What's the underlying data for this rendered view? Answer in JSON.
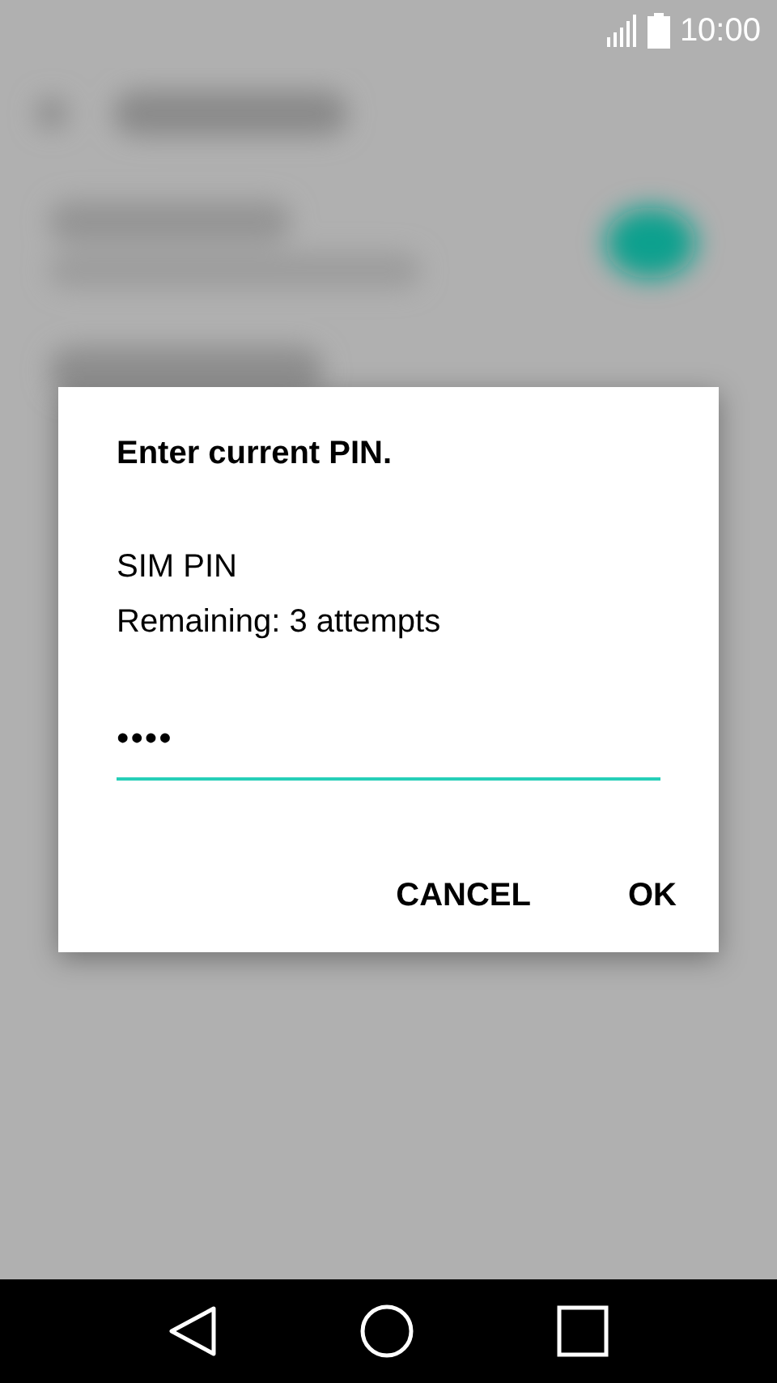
{
  "status_bar": {
    "time": "10:00"
  },
  "dialog": {
    "title": "Enter current PIN.",
    "lines": [
      "SIM PIN",
      "Remaining: 3 attempts"
    ],
    "pin_field": {
      "value": "••••",
      "focused": true
    },
    "buttons": [
      "CANCEL",
      "OK"
    ]
  }
}
